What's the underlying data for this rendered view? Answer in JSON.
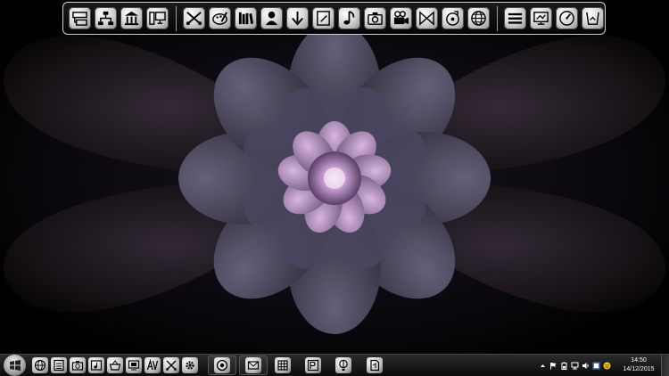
{
  "desktop": {
    "wallpaper": "purple-fractal-flower",
    "colors": {
      "petal_outer": "#3b3a4a",
      "petal_mid": "#5c5770",
      "flower_core": "#c9a2d6",
      "glow": "#8d6fa0"
    }
  },
  "top_dock": {
    "groups": [
      [
        "network-drive-icon",
        "network-tree-icon",
        "library-building-icon",
        "computer-display-icon"
      ],
      [
        "scissors-crossed-icon",
        "paint-palette-icon",
        "books-icon",
        "user-person-icon",
        "download-arrow-icon",
        "document-corner-icon",
        "music-note-icon",
        "camera-icon",
        "video-camera-icon",
        "media-player-icon",
        "audio-disc-icon",
        "globe-icon"
      ],
      [
        "menu-lines-icon",
        "display-monitor-icon",
        "clock-dial-icon",
        "trash-bin-icon"
      ]
    ]
  },
  "taskbar": {
    "start_icon": "windows-logo-icon",
    "pinned": [
      "globe-icon",
      "document-grid-icon",
      "camera-icon",
      "music-player-icon",
      "shopping-basket-icon",
      "monitor-window-icon",
      "text-av-icon",
      "scissors-crossed-icon",
      "gear-icon"
    ],
    "tasks": [
      "chrome-icon",
      "mail-icon",
      "grid-apps-icon",
      "photoshop-icon",
      "hot-air-balloon-icon",
      "document-icon"
    ],
    "tray_icons": [
      "chevron-up-icon",
      "flag-icon",
      "battery-icon",
      "network-icon",
      "volume-icon",
      "language-icon",
      "smiley-icon"
    ],
    "clock_time": "14:50",
    "clock_date": "14/12/2015"
  }
}
